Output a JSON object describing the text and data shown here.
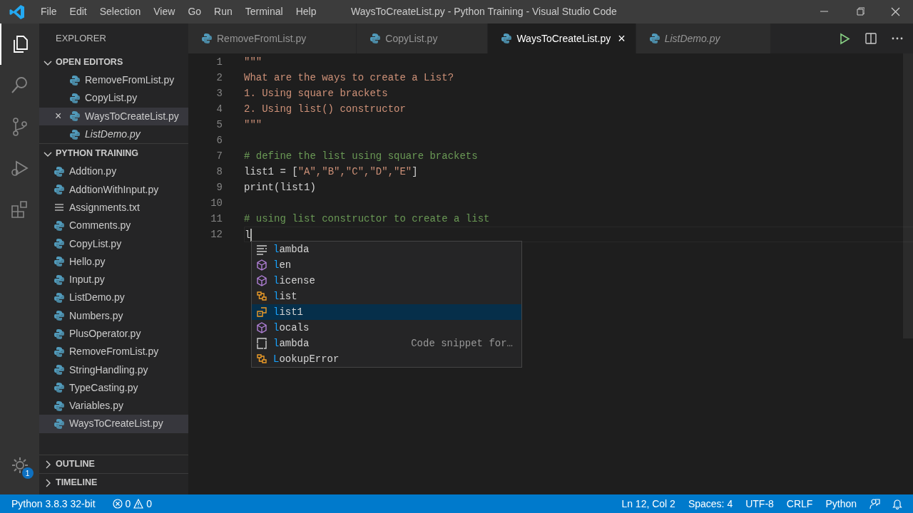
{
  "window": {
    "title": "WaysToCreateList.py - Python Training - Visual Studio Code"
  },
  "menu": [
    "File",
    "Edit",
    "Selection",
    "View",
    "Go",
    "Run",
    "Terminal",
    "Help"
  ],
  "activity_bar": {
    "settings_badge": "1"
  },
  "sidebar": {
    "title": "EXPLORER",
    "open_editors": {
      "label": "OPEN EDITORS",
      "expanded": true,
      "items": [
        {
          "name": "RemoveFromList.py",
          "kind": "python",
          "selected": false,
          "preview": false
        },
        {
          "name": "CopyList.py",
          "kind": "python",
          "selected": false,
          "preview": false
        },
        {
          "name": "WaysToCreateList.py",
          "kind": "python",
          "selected": true,
          "preview": false,
          "close": "×"
        },
        {
          "name": "ListDemo.py",
          "kind": "python",
          "selected": false,
          "preview": true
        }
      ]
    },
    "folder": {
      "label": "PYTHON TRAINING",
      "expanded": true,
      "items": [
        {
          "name": "Addtion.py",
          "kind": "python",
          "selected": false
        },
        {
          "name": "AddtionWithInput.py",
          "kind": "python",
          "selected": false
        },
        {
          "name": "Assignments.txt",
          "kind": "text",
          "selected": false
        },
        {
          "name": "Comments.py",
          "kind": "python",
          "selected": false
        },
        {
          "name": "CopyList.py",
          "kind": "python",
          "selected": false
        },
        {
          "name": "Hello.py",
          "kind": "python",
          "selected": false
        },
        {
          "name": "Input.py",
          "kind": "python",
          "selected": false
        },
        {
          "name": "ListDemo.py",
          "kind": "python",
          "selected": false
        },
        {
          "name": "Numbers.py",
          "kind": "python",
          "selected": false
        },
        {
          "name": "PlusOperator.py",
          "kind": "python",
          "selected": false
        },
        {
          "name": "RemoveFromList.py",
          "kind": "python",
          "selected": false
        },
        {
          "name": "StringHandling.py",
          "kind": "python",
          "selected": false
        },
        {
          "name": "TypeCasting.py",
          "kind": "python",
          "selected": false
        },
        {
          "name": "Variables.py",
          "kind": "python",
          "selected": false
        },
        {
          "name": "WaysToCreateList.py",
          "kind": "python",
          "selected": true
        }
      ]
    },
    "sections": [
      {
        "label": "OUTLINE",
        "expanded": false
      },
      {
        "label": "TIMELINE",
        "expanded": false
      }
    ]
  },
  "tabs": [
    {
      "label": "RemoveFromList.py",
      "selected": false,
      "preview": false
    },
    {
      "label": "CopyList.py",
      "selected": false,
      "preview": false
    },
    {
      "label": "WaysToCreateList.py",
      "selected": true,
      "preview": false,
      "close": "×"
    },
    {
      "label": "ListDemo.py",
      "selected": false,
      "preview": true
    }
  ],
  "editor": {
    "lines": [
      {
        "number": "1",
        "tokens": [
          {
            "text": "\"\"\"",
            "kind": "string"
          }
        ]
      },
      {
        "number": "2",
        "tokens": [
          {
            "text": "What are the ways to create a List?",
            "kind": "string"
          }
        ]
      },
      {
        "number": "3",
        "tokens": [
          {
            "text": "1. Using square brackets",
            "kind": "string"
          }
        ]
      },
      {
        "number": "4",
        "tokens": [
          {
            "text": "2. Using list() constructor",
            "kind": "string"
          }
        ]
      },
      {
        "number": "5",
        "tokens": [
          {
            "text": "\"\"\"",
            "kind": "string"
          }
        ]
      },
      {
        "number": "6"
      },
      {
        "number": "7",
        "tokens": [
          {
            "text": "# define the list using square brackets",
            "kind": "comment"
          }
        ]
      },
      {
        "number": "8",
        "tokens": [
          {
            "text": "list1 = [",
            "kind": "plain"
          },
          {
            "text": "\"A\",\"B\",\"C\",\"D\",\"E\"",
            "kind": "string"
          },
          {
            "text": "]",
            "kind": "plain"
          }
        ]
      },
      {
        "number": "9",
        "tokens": [
          {
            "text": "print(list1)",
            "kind": "plain"
          }
        ]
      },
      {
        "number": "10"
      },
      {
        "number": "11",
        "tokens": [
          {
            "text": "# using list constructor to create a list",
            "kind": "comment"
          }
        ]
      },
      {
        "number": "12",
        "tokens": [
          {
            "text": "l",
            "kind": "plain"
          }
        ],
        "current": true
      }
    ]
  },
  "suggestions": {
    "items": [
      {
        "label": "lambda",
        "kind": "keyword",
        "selected": false
      },
      {
        "label": "len",
        "kind": "function",
        "selected": false
      },
      {
        "label": "license",
        "kind": "function",
        "selected": false
      },
      {
        "label": "list",
        "kind": "class",
        "selected": false
      },
      {
        "label": "list1",
        "kind": "variable",
        "selected": true
      },
      {
        "label": "locals",
        "kind": "function",
        "selected": false
      },
      {
        "label": "lambda",
        "kind": "snippet",
        "selected": false,
        "detail": "Code snippet for…"
      },
      {
        "label": "LookupError",
        "kind": "class",
        "selected": false
      }
    ]
  },
  "status_bar": {
    "left": [
      {
        "text": "Python 3.8.3 32-bit",
        "kind": "text"
      },
      {
        "errors": "0",
        "warnings": "0",
        "kind": "problems"
      }
    ],
    "right": [
      "Ln 12, Col 2",
      "Spaces: 4",
      "UTF-8",
      "CRLF",
      "Python"
    ]
  }
}
